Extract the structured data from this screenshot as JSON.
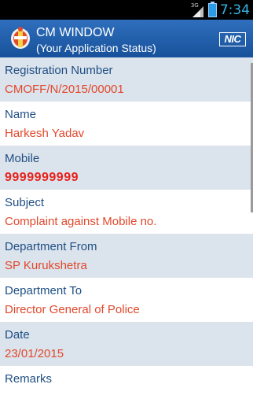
{
  "status_bar": {
    "network": "3G",
    "time": "7:34"
  },
  "header": {
    "title": "CM WINDOW",
    "subtitle": "(Your Application Status)",
    "nic_logo_text": "NIC",
    "background_color": "#1f5ea8"
  },
  "fields": [
    {
      "label": "Registration Number",
      "value": "CMOFF/N/2015/00001"
    },
    {
      "label": "Name",
      "value": "Harkesh Yadav"
    },
    {
      "label": "Mobile",
      "value": "9999999999"
    },
    {
      "label": "Subject",
      "value": "Complaint against Mobile no."
    },
    {
      "label": "Department From",
      "value": "SP Kurukshetra"
    },
    {
      "label": "Department To",
      "value": "Director General of Police"
    },
    {
      "label": "Date",
      "value": "23/01/2015"
    },
    {
      "label": "Remarks",
      "value": ""
    }
  ],
  "colors": {
    "label_color": "#1f4f84",
    "value_color": "#e2482c",
    "shaded_row": "#dbe3ec"
  }
}
